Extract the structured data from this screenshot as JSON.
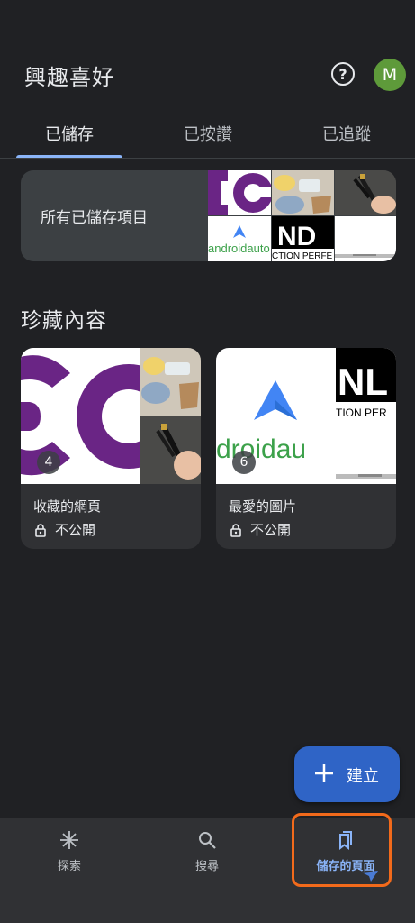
{
  "header": {
    "title": "興趣喜好",
    "help_icon": "help-circle-icon",
    "avatar_initial": "M",
    "avatar_color": "#5e9a3a"
  },
  "tabs": [
    {
      "label": "已儲存",
      "active": true
    },
    {
      "label": "已按讚",
      "active": false
    },
    {
      "label": "已追蹤",
      "active": false
    }
  ],
  "all_saved": {
    "label": "所有已儲存項目"
  },
  "collections_section": {
    "title": "珍藏內容",
    "items": [
      {
        "name": "收藏的網頁",
        "count": "4",
        "privacy": "不公開"
      },
      {
        "name": "最愛的圖片",
        "count": "6",
        "privacy": "不公開"
      }
    ]
  },
  "thumb_text": {
    "android_logo_text": "androidauto",
    "android_large_text": "droidau",
    "nd_text": "ND",
    "nd_caption": "CTION PERFE",
    "nl_text": "NL",
    "nl_caption": "TION PER"
  },
  "fab": {
    "label": "建立",
    "icon": "plus-icon"
  },
  "bottom_nav": [
    {
      "label": "探索",
      "icon": "asterisk-icon",
      "active": false
    },
    {
      "label": "搜尋",
      "icon": "search-icon",
      "active": false
    },
    {
      "label": "儲存的頁面",
      "icon": "bookmarks-icon",
      "active": true
    }
  ],
  "colors": {
    "background": "#202124",
    "accent": "#8ab4f8",
    "fab": "#2f64c6",
    "highlight": "#f26a1b"
  }
}
